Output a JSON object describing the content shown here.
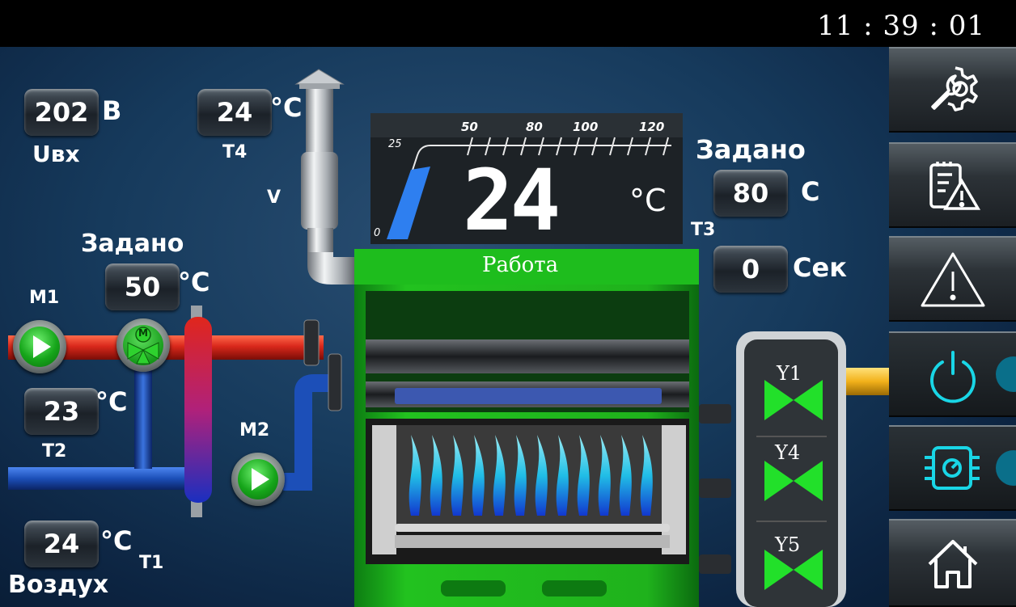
{
  "clock": "11 : 39 : 01",
  "voltage": {
    "value": "202",
    "unit": "В",
    "label": "Uвх"
  },
  "t4": {
    "value": "24",
    "unit": "°C",
    "label": "T4"
  },
  "valve_label": "V",
  "boiler": {
    "temperature": "24",
    "unit": "°C",
    "status": "Работа",
    "gauge_ticks": [
      "0",
      "25",
      "50",
      "80",
      "100",
      "120"
    ],
    "gauge_level_fraction": 0.2
  },
  "setpoint_right": {
    "title": "Задано",
    "value": "80",
    "unit": "С",
    "label": "T3"
  },
  "timer": {
    "value": "0",
    "unit": "Сек"
  },
  "setpoint_left": {
    "title": "Задано",
    "value": "50",
    "unit": "°C"
  },
  "pump_m1": {
    "label": "M1"
  },
  "pump_m2": {
    "label": "M2"
  },
  "mixer_label": "M",
  "t2": {
    "value": "23",
    "unit": "°C",
    "label": "T2"
  },
  "t1": {
    "value": "24",
    "unit": "°C",
    "label": "T1",
    "caption": "Воздух"
  },
  "valves": [
    "Y1",
    "Y4",
    "Y5"
  ],
  "sidebar": [
    "settings-icon",
    "log-warning-icon",
    "alarm-icon",
    "power-icon",
    "burner-icon",
    "home-icon"
  ],
  "colors": {
    "accent_green": "#22c21f",
    "accent_cyan": "#19d6e6",
    "hot_pipe": "#d9281b",
    "cold_pipe": "#1c4fb8"
  }
}
